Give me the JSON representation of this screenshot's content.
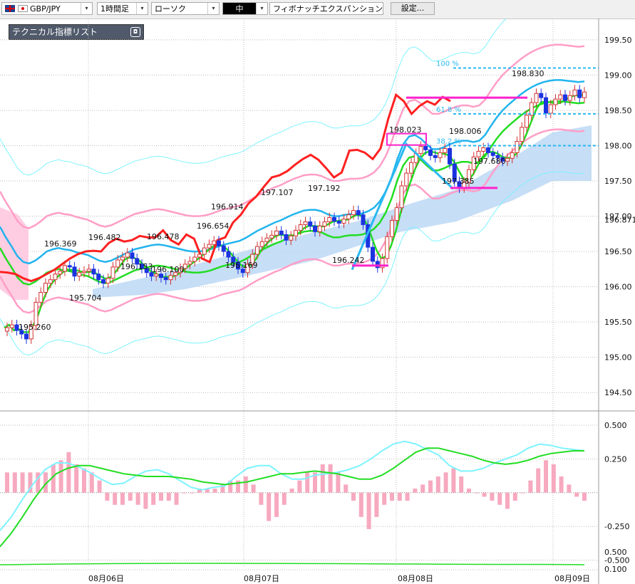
{
  "toolbar": {
    "symbol": "GBP/JPY",
    "timeframe": "1時間足",
    "chart_style": "ローソク",
    "line_width": "中",
    "drawing_tool": "フィボナッチエクスパンション",
    "settings_label": "設定..."
  },
  "panel": {
    "title": "テクニカル指標リスト"
  },
  "colors": {
    "price_line": "#ff2020",
    "bollinger": "#ff9ec7",
    "bollinger_outer": "#7df3ff",
    "ma_green": "#22dd22",
    "ma_blue": "#22b4ee",
    "cloud": "#bcd8f5",
    "fib": "#2ab8f0",
    "highlight": "#ff22cc",
    "candle_up": "#d23232",
    "candle_down": "#1b33e0",
    "macd_hist": "#f6a9bf"
  },
  "chart_data": [
    {
      "type": "line",
      "title": "",
      "ylim": [
        194.3,
        199.6
      ],
      "y_ticks": [
        "199.50",
        "199.00",
        "198.50",
        "198.00",
        "197.50",
        "197.00",
        "196.50",
        "196.00",
        "195.50",
        "195.00",
        "194.50"
      ],
      "x_ticks": [
        "08月06日",
        "08月07日",
        "08月08日",
        "08月09日"
      ],
      "current_price_label": "196.871",
      "candles": {
        "close": [
          195.42,
          195.46,
          195.38,
          195.33,
          195.26,
          195.45,
          195.78,
          195.92,
          196.05,
          196.1,
          196.18,
          196.22,
          196.3,
          196.28,
          196.15,
          196.2,
          196.22,
          196.25,
          196.18,
          196.1,
          196.05,
          196.12,
          196.28,
          196.38,
          196.42,
          196.48,
          196.4,
          196.32,
          196.26,
          196.2,
          196.15,
          196.18,
          196.13,
          196.1,
          196.16,
          196.2,
          196.26,
          196.32,
          196.36,
          196.42,
          196.46,
          196.55,
          196.6,
          196.65,
          196.58,
          196.5,
          196.42,
          196.35,
          196.25,
          196.2,
          196.32,
          196.46,
          196.57,
          196.64,
          196.69,
          196.73,
          196.79,
          196.74,
          196.66,
          196.72,
          196.8,
          196.88,
          196.92,
          196.86,
          196.78,
          196.86,
          196.92,
          196.98,
          196.93,
          196.9,
          196.96,
          197.02,
          197.08,
          197.02,
          196.88,
          196.56,
          196.36,
          196.27,
          196.4,
          196.71,
          196.94,
          197.12,
          197.43,
          197.61,
          197.76,
          197.89,
          197.99,
          197.94,
          197.86,
          197.83,
          197.9,
          197.96,
          197.74,
          197.49,
          197.4,
          197.48,
          197.66,
          197.84,
          197.92,
          197.97,
          197.9,
          197.86,
          197.83,
          197.78,
          197.82,
          197.9,
          198.06,
          198.26,
          198.43,
          198.61,
          198.74,
          198.68,
          198.46,
          198.58,
          198.66,
          198.72,
          198.64,
          198.71,
          198.79,
          198.68,
          198.76
        ]
      },
      "series": [
        {
          "values": [
            196.21,
            196.2,
            196.18,
            196.12,
            196.08,
            196.12,
            196.18,
            196.24,
            196.32,
            196.4,
            196.46,
            196.5,
            196.51,
            196.5,
            196.62,
            196.68,
            196.64,
            196.66,
            196.72,
            196.7,
            196.7,
            196.8,
            196.66,
            196.6,
            196.74,
            196.68,
            196.4,
            196.35,
            196.66,
            196.7,
            196.91,
            197.02,
            197.18,
            197.28,
            197.42,
            197.55,
            197.58,
            197.64,
            197.73,
            197.81,
            197.87,
            197.8,
            197.68,
            197.55,
            197.62,
            197.93,
            197.94,
            197.9,
            197.81,
            197.96,
            198.38,
            198.72,
            198.63,
            198.45,
            198.56,
            198.63,
            198.58,
            198.69,
            198.63
          ]
        },
        {
          "name": "",
          "values": [
            196.9,
            196.75,
            196.62,
            196.48,
            196.4,
            196.38,
            196.42,
            196.48,
            196.55,
            196.58,
            196.6,
            196.58,
            196.57,
            196.54,
            196.52,
            196.5,
            196.46,
            196.42,
            196.4,
            196.42,
            196.46,
            196.5,
            196.54,
            196.58,
            196.6,
            196.62,
            196.64,
            196.65,
            196.64,
            196.62,
            196.6,
            196.58,
            196.56,
            196.55,
            196.55,
            196.56,
            196.58,
            196.61,
            196.64,
            196.66,
            196.68,
            196.7,
            196.74,
            196.79,
            196.84,
            196.88,
            196.92,
            196.96,
            196.99,
            197.03,
            197.07,
            197.1,
            197.13,
            197.14,
            197.14,
            197.12,
            197.08,
            197.05,
            197.05,
            197.07,
            197.08,
            197.08,
            197.09,
            197.12,
            197.17,
            197.26,
            197.4,
            197.6,
            197.86,
            198.07,
            198.18,
            198.2,
            198.15,
            198.07,
            198.0,
            198.0,
            198.03,
            198.07,
            198.1,
            198.12,
            198.12,
            198.1,
            198.12,
            198.2,
            198.33,
            198.45,
            198.55,
            198.63,
            198.7,
            198.77,
            198.83,
            198.88,
            198.92,
            198.95,
            198.97,
            198.98,
            198.98,
            198.97,
            198.96,
            198.95,
            198.96
          ]
        }
      ]
    },
    {
      "type": "line",
      "title": "",
      "ylim": [
        -0.55,
        0.6
      ],
      "y_ticks": [
        "0.500",
        "0.250",
        "-0.250",
        "-0.500"
      ],
      "series": [
        {
          "values": [
            -0.28,
            -0.18,
            -0.05,
            0.07,
            0.17,
            0.22,
            0.22,
            0.19,
            0.15,
            0.1,
            0.06,
            0.07,
            0.12,
            0.16,
            0.17,
            0.14,
            0.09,
            0.04,
            0.02,
            0.04,
            0.05,
            0.12,
            0.18,
            0.2,
            0.2,
            0.14,
            0.1,
            0.1,
            0.13,
            0.14,
            0.15,
            0.17,
            0.2,
            0.25,
            0.31,
            0.36,
            0.38,
            0.36,
            0.32,
            0.28,
            0.2,
            0.16,
            0.16,
            0.18,
            0.22,
            0.25,
            0.28,
            0.33,
            0.36,
            0.35,
            0.33,
            0.32,
            0.31
          ]
        },
        {
          "values": [
            -0.4,
            -0.3,
            -0.18,
            -0.05,
            0.06,
            0.14,
            0.18,
            0.2,
            0.2,
            0.18,
            0.16,
            0.14,
            0.13,
            0.12,
            0.12,
            0.12,
            0.11,
            0.1,
            0.08,
            0.07,
            0.06,
            0.07,
            0.08,
            0.1,
            0.12,
            0.14,
            0.14,
            0.15,
            0.16,
            0.15,
            0.14,
            0.12,
            0.1,
            0.1,
            0.13,
            0.18,
            0.24,
            0.3,
            0.33,
            0.33,
            0.31,
            0.29,
            0.27,
            0.24,
            0.22,
            0.21,
            0.22,
            0.24,
            0.27,
            0.29,
            0.3,
            0.31,
            0.31
          ]
        }
      ],
      "histogram": [
        0.05,
        0.05,
        0.05,
        0.05,
        0.05,
        0.05,
        0.07,
        0.08,
        0.1,
        0.07,
        0.06,
        0.05,
        0.03,
        -0.02,
        -0.03,
        -0.03,
        -0.02,
        -0.03,
        -0.04,
        -0.03,
        -0.02,
        -0.02,
        -0.03,
        0.0,
        0.0,
        0.01,
        0.01,
        0.01,
        0.02,
        0.03,
        0.03,
        0.04,
        0.02,
        -0.03,
        -0.07,
        -0.06,
        -0.03,
        0.01,
        0.03,
        0.05,
        0.05,
        0.07,
        0.07,
        0.05,
        0.02,
        -0.02,
        -0.06,
        -0.09,
        -0.06,
        -0.03,
        -0.02,
        -0.02,
        -0.02,
        0.01,
        0.02,
        0.03,
        0.04,
        0.05,
        0.06,
        0.04,
        0.01,
        0.0,
        -0.01,
        -0.02,
        -0.03,
        -0.04,
        -0.02,
        0.0,
        0.03,
        0.06,
        0.08,
        0.07,
        0.04,
        0.02,
        -0.01,
        -0.02
      ]
    }
  ],
  "annotations": {
    "lows_highs": [
      "195.260",
      "195.704",
      "196.369",
      "196.153",
      "196.482",
      "196.100",
      "196.478",
      "196.654",
      "196.914",
      "196.169",
      "197.107",
      "197.192",
      "196.242",
      "198.023",
      "198.006",
      "197.680",
      "197.385",
      "198.830"
    ],
    "fib_labels": [
      "100 %",
      "61.8 %",
      "38.2 %"
    ]
  }
}
